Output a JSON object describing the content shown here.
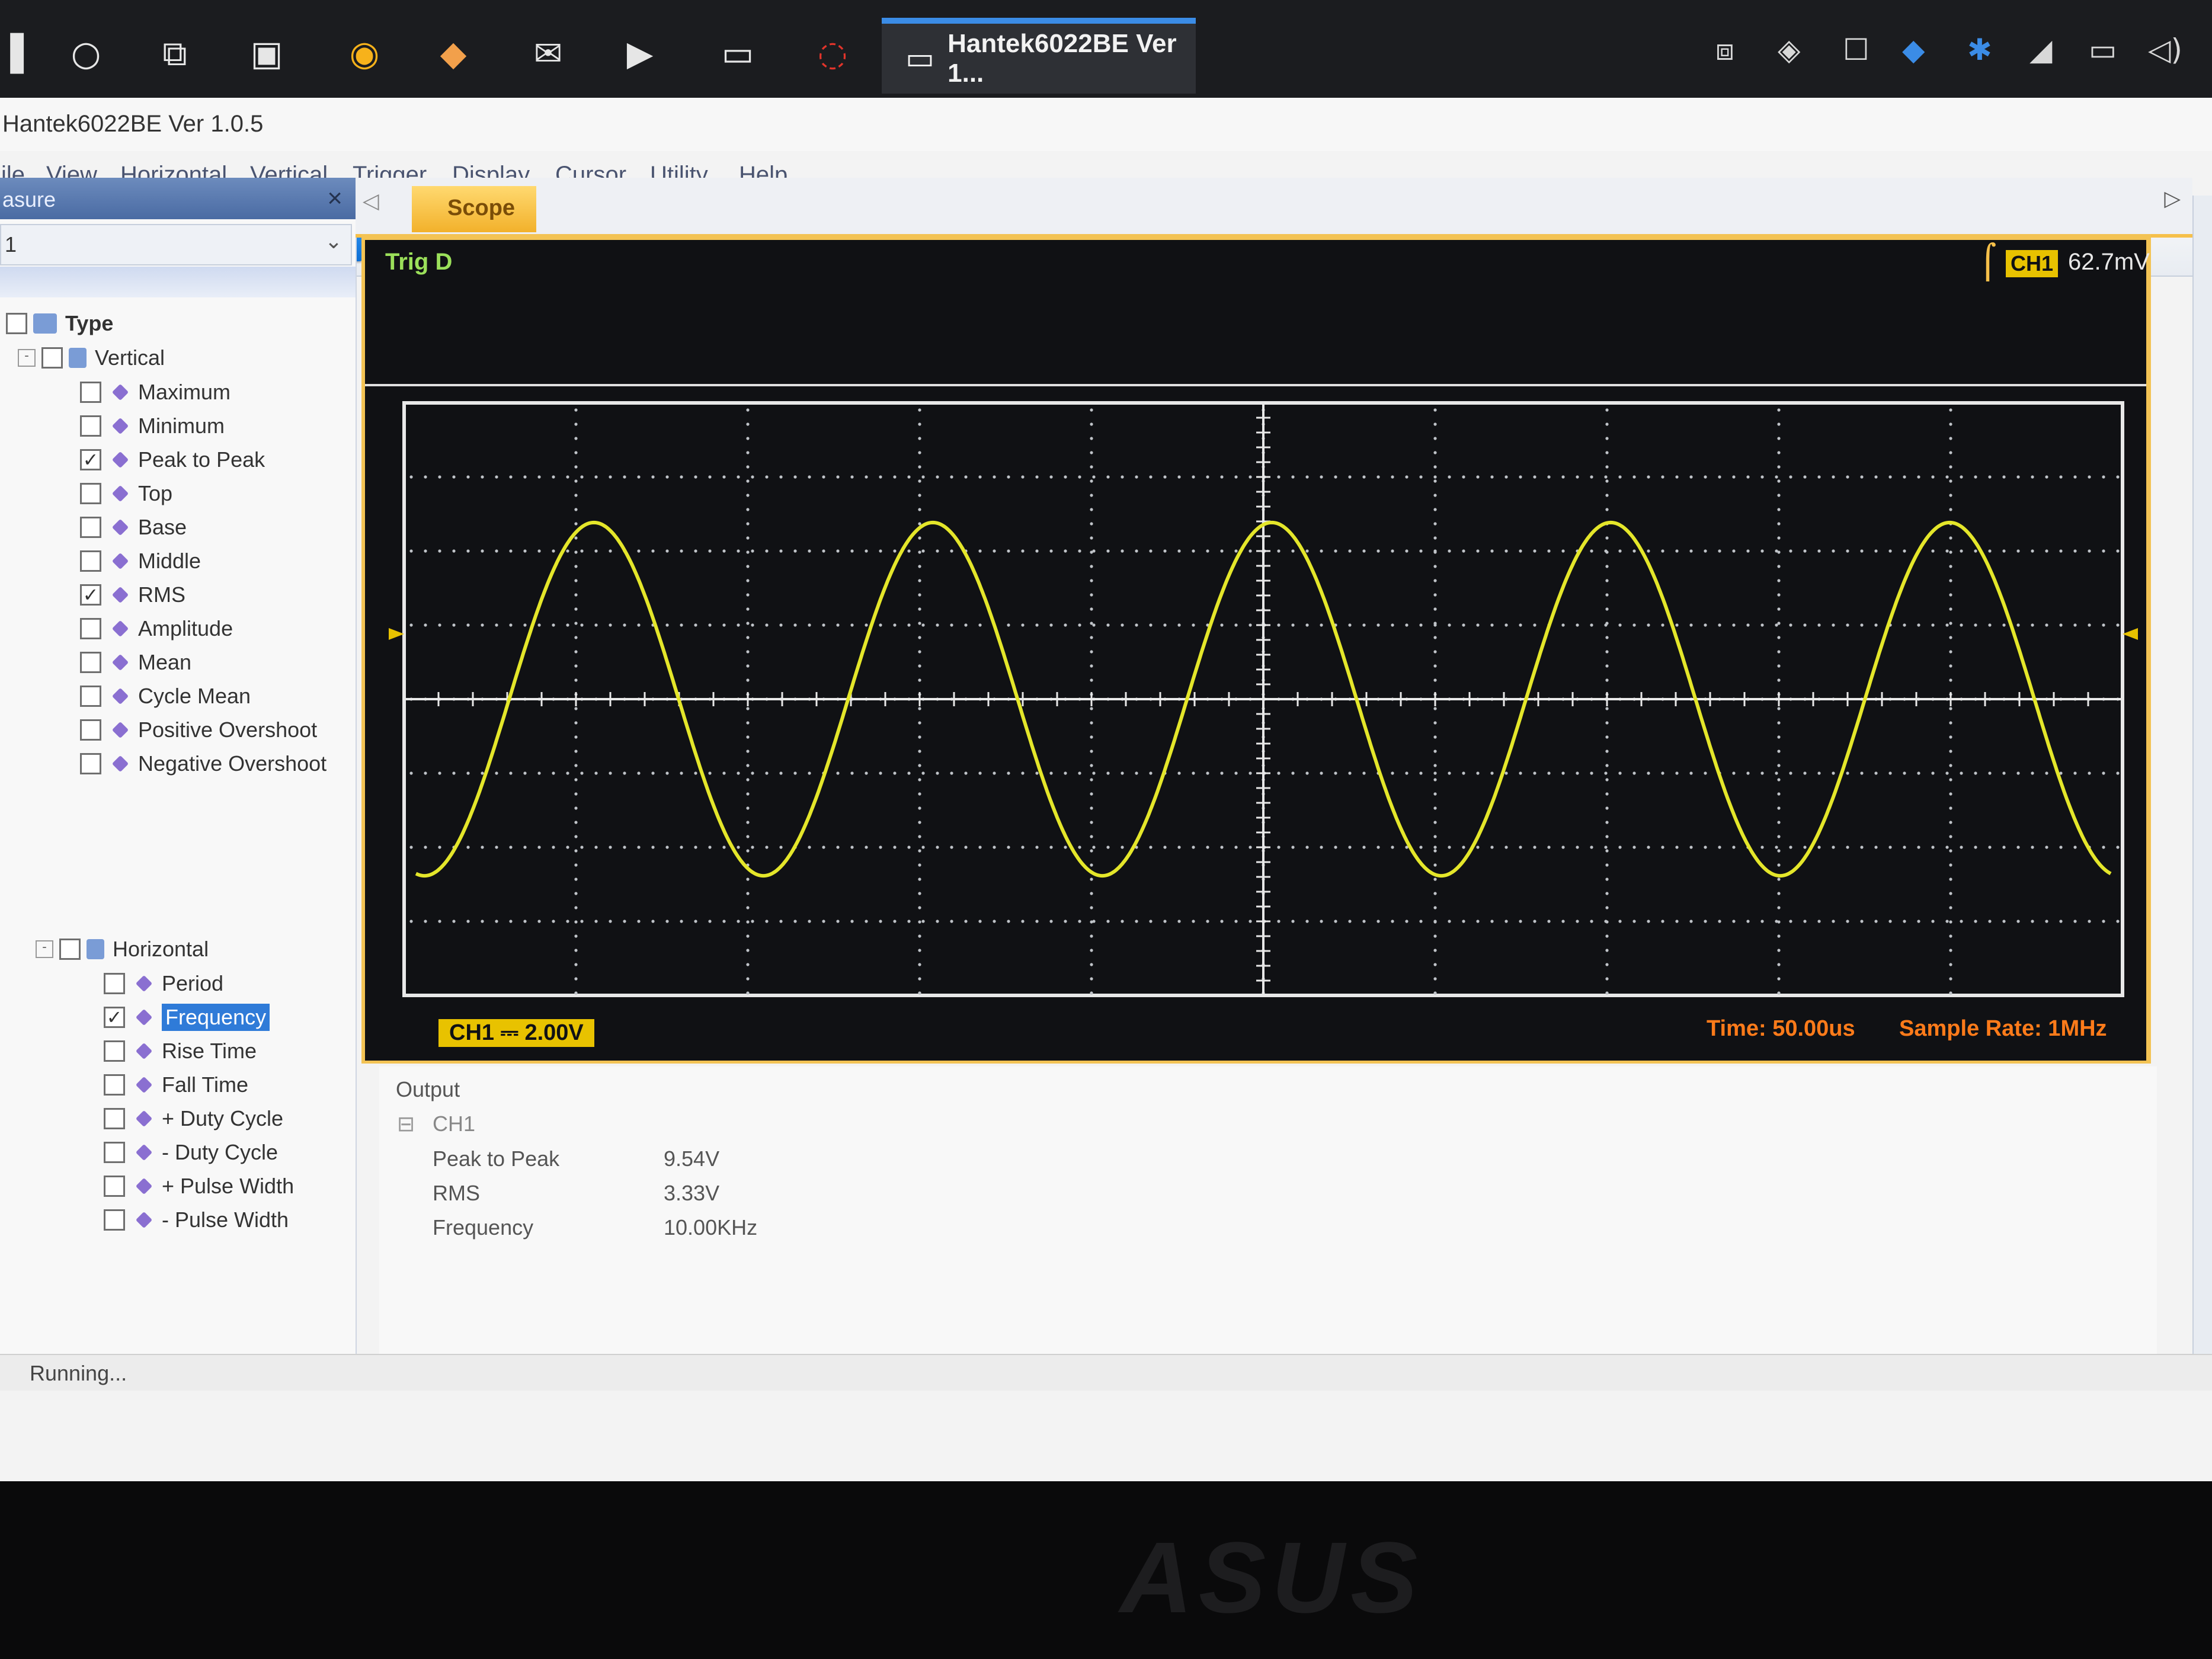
{
  "taskbar": {
    "active_window": "Hantek6022BE Ver 1...",
    "icons": [
      "windows-start-icon",
      "cortana-icon",
      "task-view-icon",
      "store-icon",
      "chrome-icon",
      "paint-icon",
      "mail-icon",
      "media-icon",
      "monitor-icon",
      "opera-icon"
    ],
    "tray": [
      "network-icon",
      "defender-icon",
      "window-icon",
      "shield-icon",
      "bluetooth-icon",
      "wifi-icon",
      "battery-icon",
      "volume-icon"
    ]
  },
  "app": {
    "title": "Hantek6022BE Ver 1.0.5",
    "menu": [
      "ile",
      "View",
      "Horizontal",
      "Vertical",
      "Trigger",
      "Display",
      "Cursor",
      "Utility",
      "Help"
    ]
  },
  "measure": {
    "panel_title": "asure",
    "select_value": "1",
    "tree_root": "Type",
    "vertical_group": "Vertical",
    "vertical_items": [
      {
        "label": "Maximum",
        "checked": false
      },
      {
        "label": "Minimum",
        "checked": false
      },
      {
        "label": "Peak to Peak",
        "checked": true
      },
      {
        "label": "Top",
        "checked": false
      },
      {
        "label": "Base",
        "checked": false
      },
      {
        "label": "Middle",
        "checked": false
      },
      {
        "label": "RMS",
        "checked": true
      },
      {
        "label": "Amplitude",
        "checked": false
      },
      {
        "label": "Mean",
        "checked": false
      },
      {
        "label": "Cycle Mean",
        "checked": false
      },
      {
        "label": "Positive Overshoot",
        "checked": false
      },
      {
        "label": "Negative Overshoot",
        "checked": false
      }
    ],
    "horizontal_group": "Horizontal",
    "horizontal_items": [
      {
        "label": "Period",
        "checked": false
      },
      {
        "label": "Frequency",
        "checked": true,
        "selected": true
      },
      {
        "label": "Rise Time",
        "checked": false
      },
      {
        "label": "Fall Time",
        "checked": false
      },
      {
        "label": "+ Duty Cycle",
        "checked": false
      },
      {
        "label": "- Duty Cycle",
        "checked": false
      },
      {
        "label": "+ Pulse Width",
        "checked": false
      },
      {
        "label": "- Pulse Width",
        "checked": false
      }
    ]
  },
  "scope": {
    "tab_label": "Scope",
    "trigger_status": "Trig D",
    "trigger_channel": "CH1",
    "trigger_level": "62.7mV",
    "channel_scale": "CH1 ⎓  2.00V",
    "time_base": "Time: 50.00us",
    "sample_rate": "Sample Rate: 1MHz",
    "colors": {
      "trace": "#e4e62a",
      "grid": "#bfc3c8",
      "background": "#101114",
      "accent": "#f3c354"
    },
    "waveform": {
      "shape": "sine",
      "frequency_hz": 10000,
      "peak_to_peak_v": 9.54,
      "volts_per_div": 2.0,
      "time_per_div_us": 50,
      "cycles_on_screen": 5
    }
  },
  "output": {
    "title": "Output",
    "channel": "CH1",
    "rows": [
      {
        "name": "Peak to Peak",
        "value": "9.54V"
      },
      {
        "name": "RMS",
        "value": "3.33V"
      },
      {
        "name": "Frequency",
        "value": "10.00KHz"
      }
    ]
  },
  "status": "Running...",
  "bezel_brand": "ASUS"
}
